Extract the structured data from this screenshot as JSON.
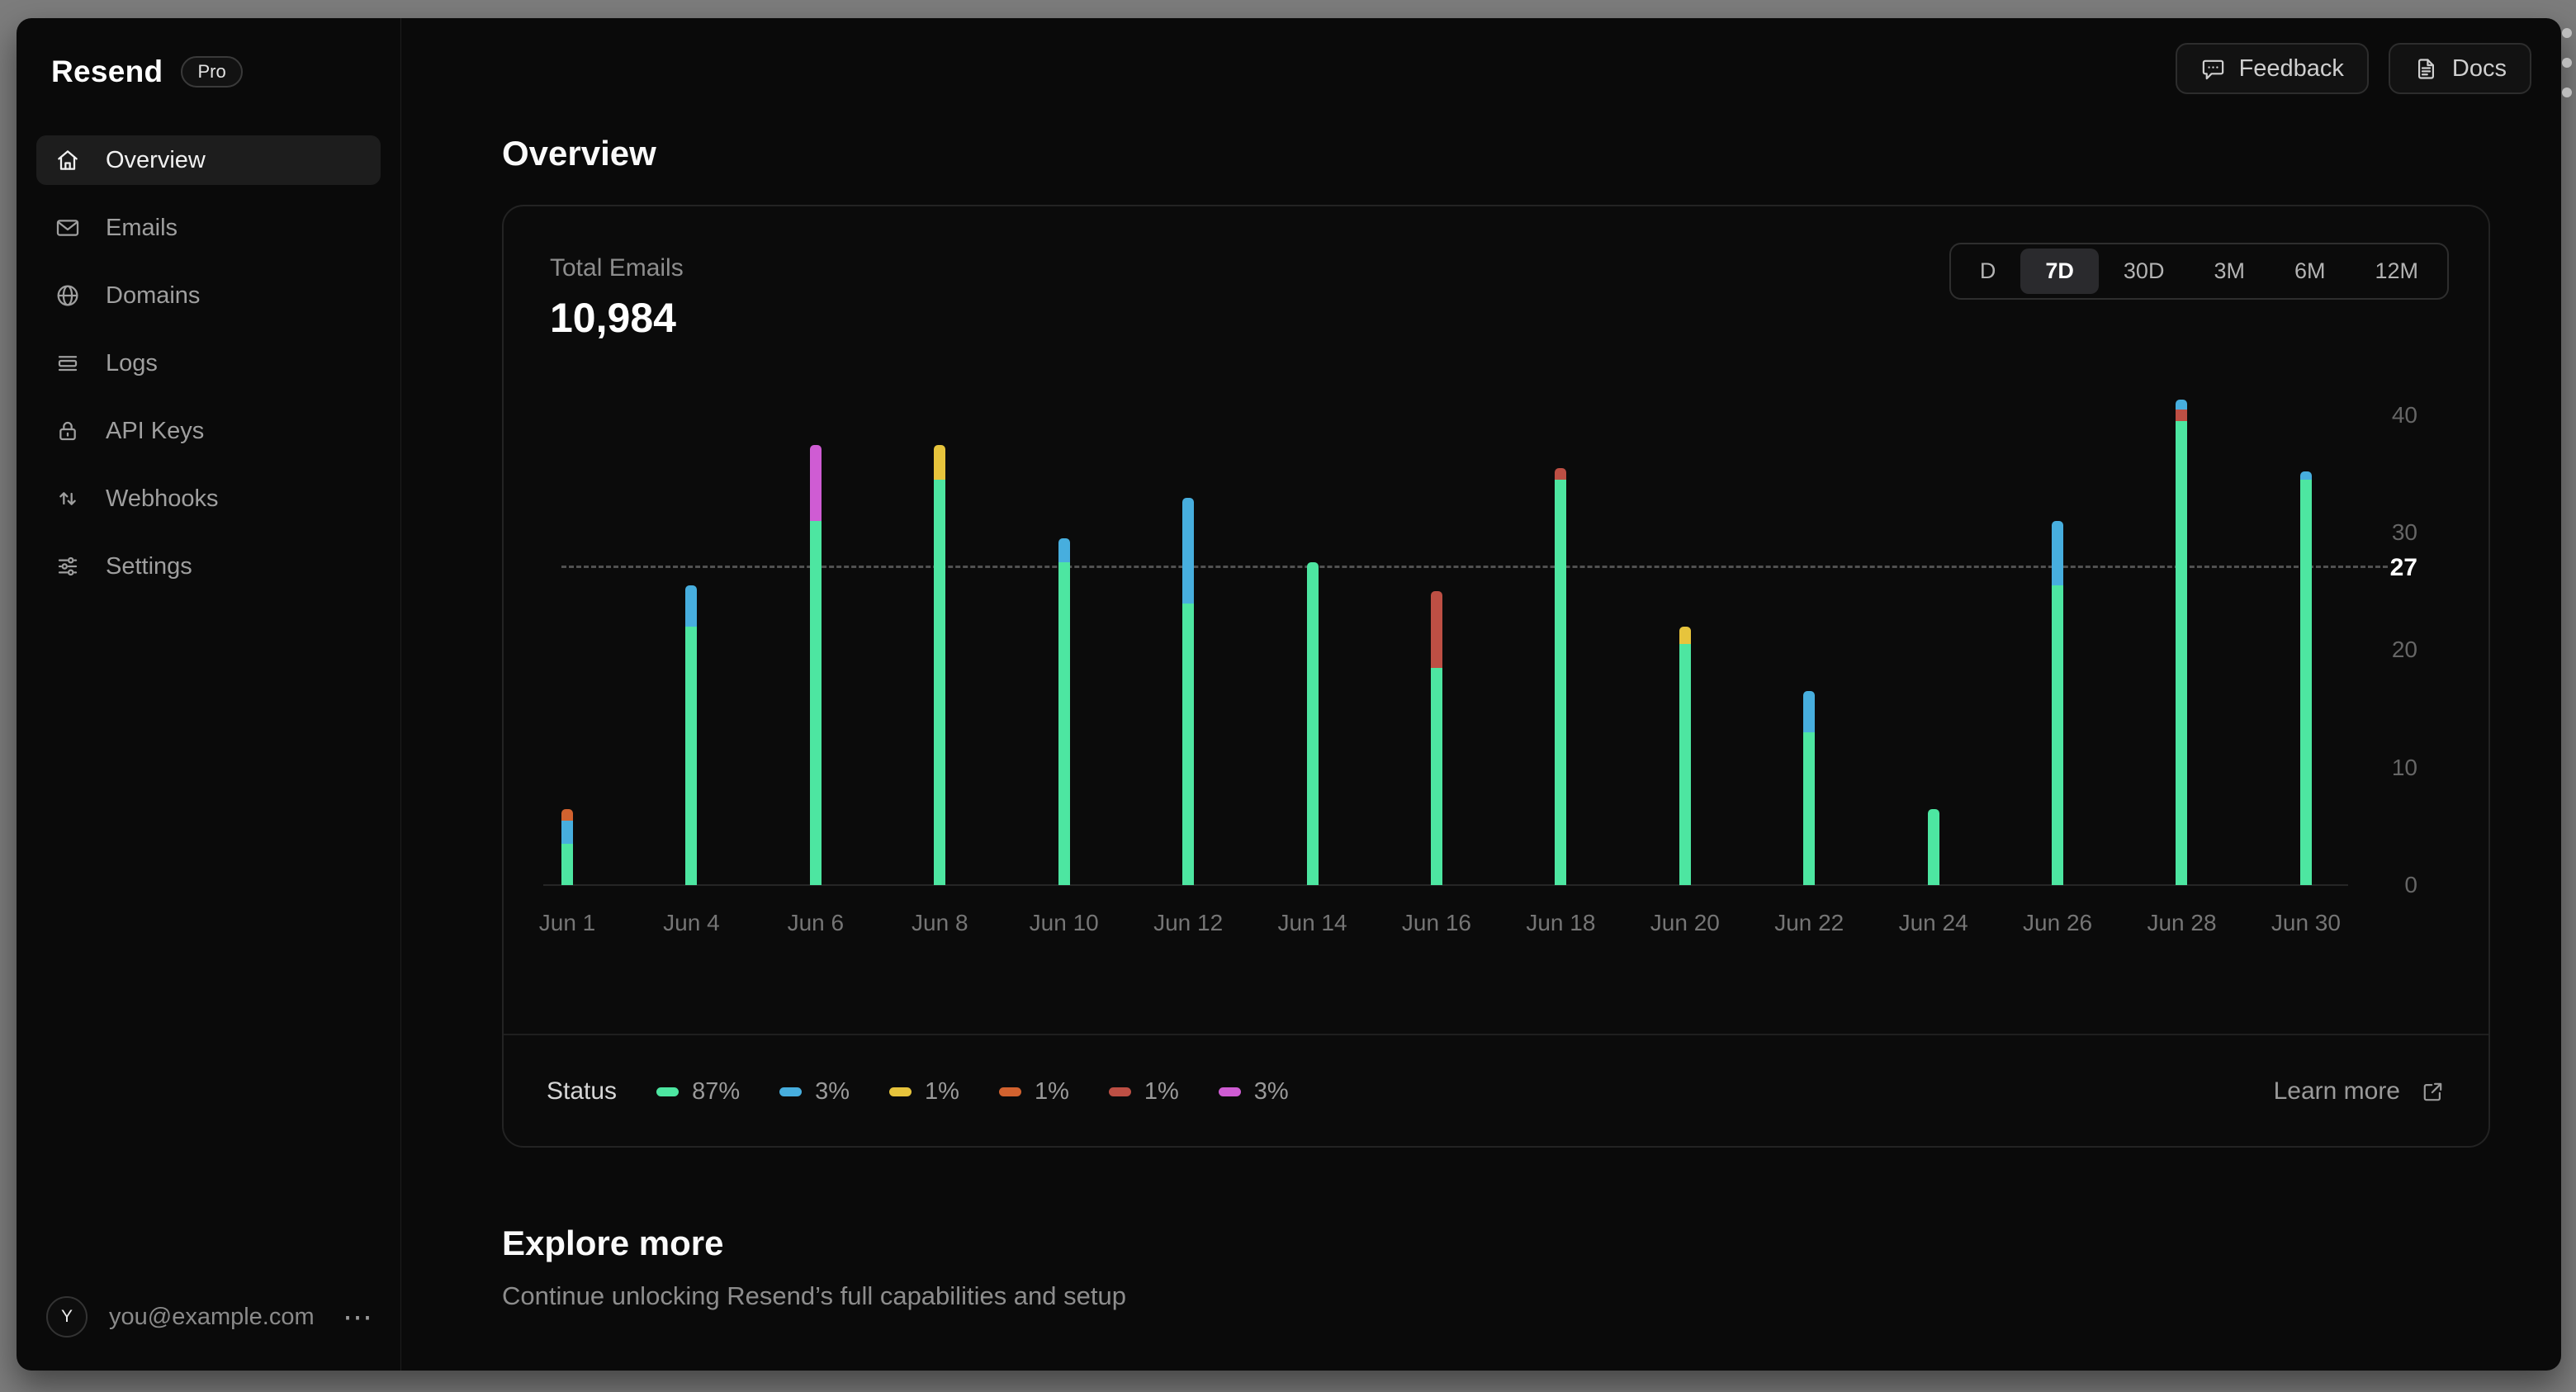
{
  "sidebar": {
    "logo": "Resend",
    "badge": "Pro",
    "items": [
      {
        "key": "overview",
        "label": "Overview",
        "icon": "home",
        "active": true
      },
      {
        "key": "emails",
        "label": "Emails",
        "icon": "mail",
        "active": false
      },
      {
        "key": "domains",
        "label": "Domains",
        "icon": "globe",
        "active": false
      },
      {
        "key": "logs",
        "label": "Logs",
        "icon": "logs",
        "active": false
      },
      {
        "key": "api-keys",
        "label": "API Keys",
        "icon": "lock",
        "active": false
      },
      {
        "key": "webhooks",
        "label": "Webhooks",
        "icon": "arrows-up-down",
        "active": false
      },
      {
        "key": "settings",
        "label": "Settings",
        "icon": "sliders",
        "active": false
      }
    ],
    "user": {
      "initial": "Y",
      "email": "you@example.com",
      "menu": "⋯"
    }
  },
  "topbar": {
    "feedback_label": "Feedback",
    "docs_label": "Docs"
  },
  "page": {
    "title": "Overview"
  },
  "card": {
    "metric_label": "Total Emails",
    "metric_value": "10,984",
    "ranges": [
      {
        "label": "D",
        "active": false
      },
      {
        "label": "7D",
        "active": true
      },
      {
        "label": "30D",
        "active": false
      },
      {
        "label": "3M",
        "active": false
      },
      {
        "label": "6M",
        "active": false
      },
      {
        "label": "12M",
        "active": false
      }
    ],
    "learn_more": "Learn more"
  },
  "chart_data": {
    "type": "bar",
    "stacked": true,
    "title": "Total Emails",
    "total_label": "10,984",
    "categories": [
      "Jun 1",
      "Jun 4",
      "Jun 6",
      "Jun 8",
      "Jun 10",
      "Jun 12",
      "Jun 14",
      "Jun 16",
      "Jun 18",
      "Jun 20",
      "Jun 22",
      "Jun 24",
      "Jun 26",
      "Jun 28",
      "Jun 30"
    ],
    "ylim": [
      0,
      44
    ],
    "yticks": [
      0,
      10,
      20,
      30,
      40
    ],
    "reference_line": {
      "value": 27,
      "label": "27",
      "style": "dashed"
    },
    "legend_title": "Status",
    "legend_position": "bottom",
    "grid": false,
    "statuses": [
      {
        "key": "green",
        "color": "#4de6a1",
        "pct": "87%",
        "dotted": false
      },
      {
        "key": "blue",
        "color": "#47aede",
        "pct": "3%",
        "dotted": false
      },
      {
        "key": "yellow",
        "color": "#e7c43c",
        "pct": "1%",
        "dotted": false
      },
      {
        "key": "orange",
        "color": "#d2622f",
        "pct": "1%",
        "dotted": true
      },
      {
        "key": "red",
        "color": "#bd4f44",
        "pct": "1%",
        "dotted": false
      },
      {
        "key": "purple",
        "color": "#cf5cd3",
        "pct": "3%",
        "dotted": false
      }
    ],
    "bars": [
      {
        "label": "Jun 1",
        "segments": [
          {
            "status": "green",
            "value": 3.5
          },
          {
            "status": "blue",
            "value": 2
          },
          {
            "status": "orange",
            "value": 1
          }
        ]
      },
      {
        "label": "Jun 4",
        "segments": [
          {
            "status": "green",
            "value": 22
          },
          {
            "status": "blue",
            "value": 3.5
          }
        ]
      },
      {
        "label": "Jun 6",
        "segments": [
          {
            "status": "green",
            "value": 31
          },
          {
            "status": "purple",
            "value": 6.5
          }
        ]
      },
      {
        "label": "Jun 8",
        "segments": [
          {
            "status": "green",
            "value": 34.5
          },
          {
            "status": "yellow",
            "value": 3
          }
        ]
      },
      {
        "label": "Jun 10",
        "segments": [
          {
            "status": "green",
            "value": 27.5
          },
          {
            "status": "blue",
            "value": 2
          }
        ]
      },
      {
        "label": "Jun 12",
        "segments": [
          {
            "status": "green",
            "value": 24
          },
          {
            "status": "blue",
            "value": 9
          }
        ]
      },
      {
        "label": "Jun 14",
        "segments": [
          {
            "status": "green",
            "value": 27.5
          }
        ]
      },
      {
        "label": "Jun 16",
        "segments": [
          {
            "status": "green",
            "value": 18.5
          },
          {
            "status": "red",
            "value": 6.5
          }
        ]
      },
      {
        "label": "Jun 18",
        "segments": [
          {
            "status": "green",
            "value": 34.5
          },
          {
            "status": "red",
            "value": 1
          }
        ]
      },
      {
        "label": "Jun 20",
        "segments": [
          {
            "status": "green",
            "value": 20.5
          },
          {
            "status": "yellow",
            "value": 1.5
          }
        ]
      },
      {
        "label": "Jun 22",
        "segments": [
          {
            "status": "green",
            "value": 13
          },
          {
            "status": "blue",
            "value": 3.5
          }
        ]
      },
      {
        "label": "Jun 24",
        "segments": [
          {
            "status": "green",
            "value": 6.5
          }
        ]
      },
      {
        "label": "Jun 26",
        "segments": [
          {
            "status": "green",
            "value": 25.5
          },
          {
            "status": "blue",
            "value": 5.5
          }
        ]
      },
      {
        "label": "Jun 28",
        "segments": [
          {
            "status": "green",
            "value": 39.5
          },
          {
            "status": "red",
            "value": 1
          },
          {
            "status": "blue",
            "value": 0.8
          }
        ]
      },
      {
        "label": "Jun 30",
        "segments": [
          {
            "status": "green",
            "value": 34.5
          },
          {
            "status": "blue",
            "value": 0.7
          }
        ]
      }
    ]
  },
  "explore": {
    "title": "Explore more",
    "subtitle": "Continue unlocking Resend’s full capabilities and setup"
  }
}
